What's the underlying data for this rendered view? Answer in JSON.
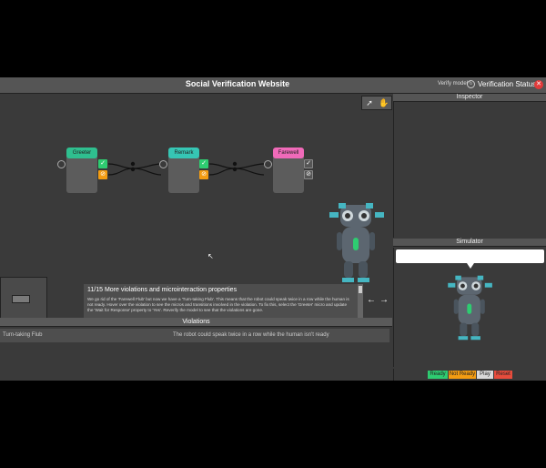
{
  "header": {
    "title": "Social Verification Website",
    "verify_label": "Verify model",
    "verify_icon": "sync-icon",
    "status_label": "Verification Status:",
    "status_icon": "x-circle-icon",
    "status_color": "#e23b3b"
  },
  "toolbar": {
    "tools": [
      "pointer-tool-icon",
      "hand-tool-icon"
    ]
  },
  "nodes": [
    {
      "label": "Greeter",
      "color": "#2fbf8f"
    },
    {
      "label": "Remark",
      "color": "#36c6b4"
    },
    {
      "label": "Farewell",
      "color": "#f06ab9"
    }
  ],
  "panels": {
    "inspector_title": "Inspector",
    "simulator_title": "Simulator"
  },
  "simulator": {
    "legend": [
      {
        "label": "Ready",
        "color": "#2ecc71"
      },
      {
        "label": "Not Ready",
        "color": "#f39c12"
      },
      {
        "label": "Play",
        "color": "#d9d9d9"
      },
      {
        "label": "Reset",
        "color": "#e74c3c"
      }
    ]
  },
  "tutorial": {
    "title": "11/15 More violations and microinteraction properties",
    "body": "We go rid of the 'Farewell Flub' but now we have a 'Turn-taking Flub'. This means that the robot could speak twice in a row while the human is not ready. Hover over the violation to see the micros and transitions involved in the violation. To fix this, select the 'Greeter' micro and update the 'Wait for Response' property to 'Yes'. Reverify the model to see that the violations are gone.",
    "prev_label": "←",
    "next_label": "→"
  },
  "violations": {
    "title": "Violations",
    "rows": [
      {
        "name": "Turn-taking Flub",
        "description": "The robot could speak twice in a row while the human isn't ready"
      }
    ]
  }
}
